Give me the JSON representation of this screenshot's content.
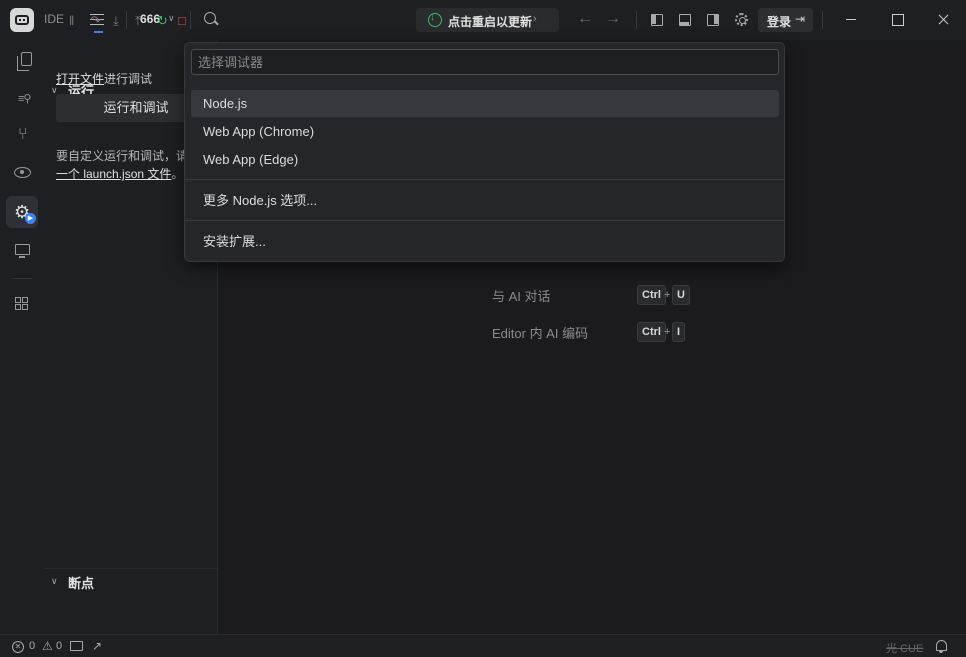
{
  "titlebar": {
    "app_name": "IDE",
    "project_name": "666",
    "update_label": "点击重启以更新",
    "login_label": "登录",
    "icons": [
      "app-logo-icon",
      "menu-icon",
      "search-icon",
      "update-icon",
      "back-arrow-icon",
      "forward-arrow-icon",
      "toggle-primary-sidebar-icon",
      "toggle-panel-icon",
      "toggle-secondary-sidebar-icon",
      "settings-icon",
      "login-icon",
      "minimize-icon",
      "maximize-icon",
      "close-icon"
    ]
  },
  "activitybar": {
    "items": [
      "explorer",
      "search",
      "source-control",
      "preview",
      "run-and-debug",
      "remote",
      "extensions"
    ],
    "active": "run-and-debug"
  },
  "sidebar": {
    "run_section_title": "运行",
    "open_file_link": "打开文件",
    "open_file_suffix": "进行调试",
    "run_debug_button": "运行和调试",
    "custom_text_prefix": "要自定义运行和调试，请",
    "custom_text_link": "一个 launch.json 文件",
    "custom_text_suffix": "。",
    "breakpoints_title": "断点"
  },
  "quickpick": {
    "placeholder": "选择调试器",
    "items": [
      "Node.js",
      "Web App (Chrome)",
      "Web App (Edge)"
    ],
    "selected_index": 0,
    "more_label": "更多 Node.js 选项...",
    "install_label": "安装扩展..."
  },
  "editor": {
    "hints": [
      {
        "label": "与 AI 对话",
        "key1": "Ctrl",
        "key2": "U"
      },
      {
        "label": "Editor 内 AI 编码",
        "key1": "Ctrl",
        "key2": "I"
      }
    ],
    "plus": "+"
  },
  "statusbar": {
    "errors": "0",
    "warnings": "0",
    "encoding": "光 CUE"
  },
  "colors": {
    "accent": "#3b82f6",
    "update_green": "#3fb56a",
    "stop_red": "#e05252"
  }
}
